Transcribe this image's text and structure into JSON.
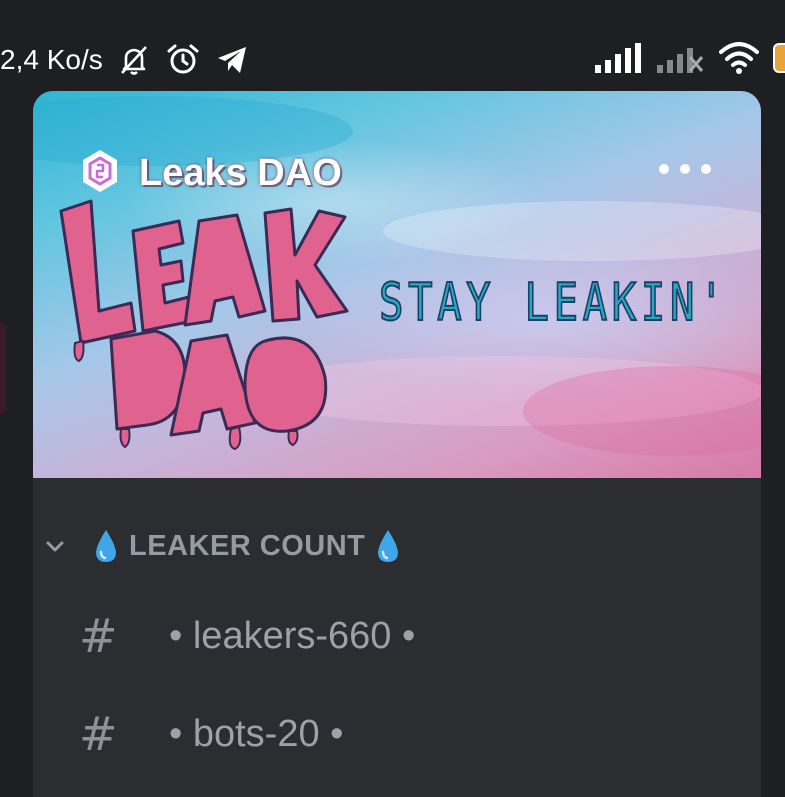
{
  "status_bar": {
    "network_speed": "2,4 Ko/s",
    "icons": [
      "bell-off-icon",
      "alarm-icon",
      "telegram-icon",
      "signal-icon",
      "signal-no-service-icon",
      "wifi-icon",
      "battery-icon"
    ]
  },
  "server": {
    "name": "Leaks DAO",
    "banner_logo_text": "LEAKS DAO",
    "banner_tagline": "STAY LEAKIN'",
    "more_icon": "more-horizontal-icon",
    "badge_icon": "server-boost-badge-icon"
  },
  "category": {
    "prefix_emoji": "💧",
    "label": "LEAKER COUNT",
    "suffix_emoji": "💧"
  },
  "channels": [
    {
      "hash": "#",
      "name": "• leakers-660 •"
    },
    {
      "hash": "#",
      "name": "• bots-20 •"
    }
  ],
  "colors": {
    "background": "#1e1f22",
    "panel": "#2b2d31",
    "muted_text": "#949ba4",
    "logo_pink": "#e0638f",
    "tagline_teal": "#2aa7c4"
  }
}
